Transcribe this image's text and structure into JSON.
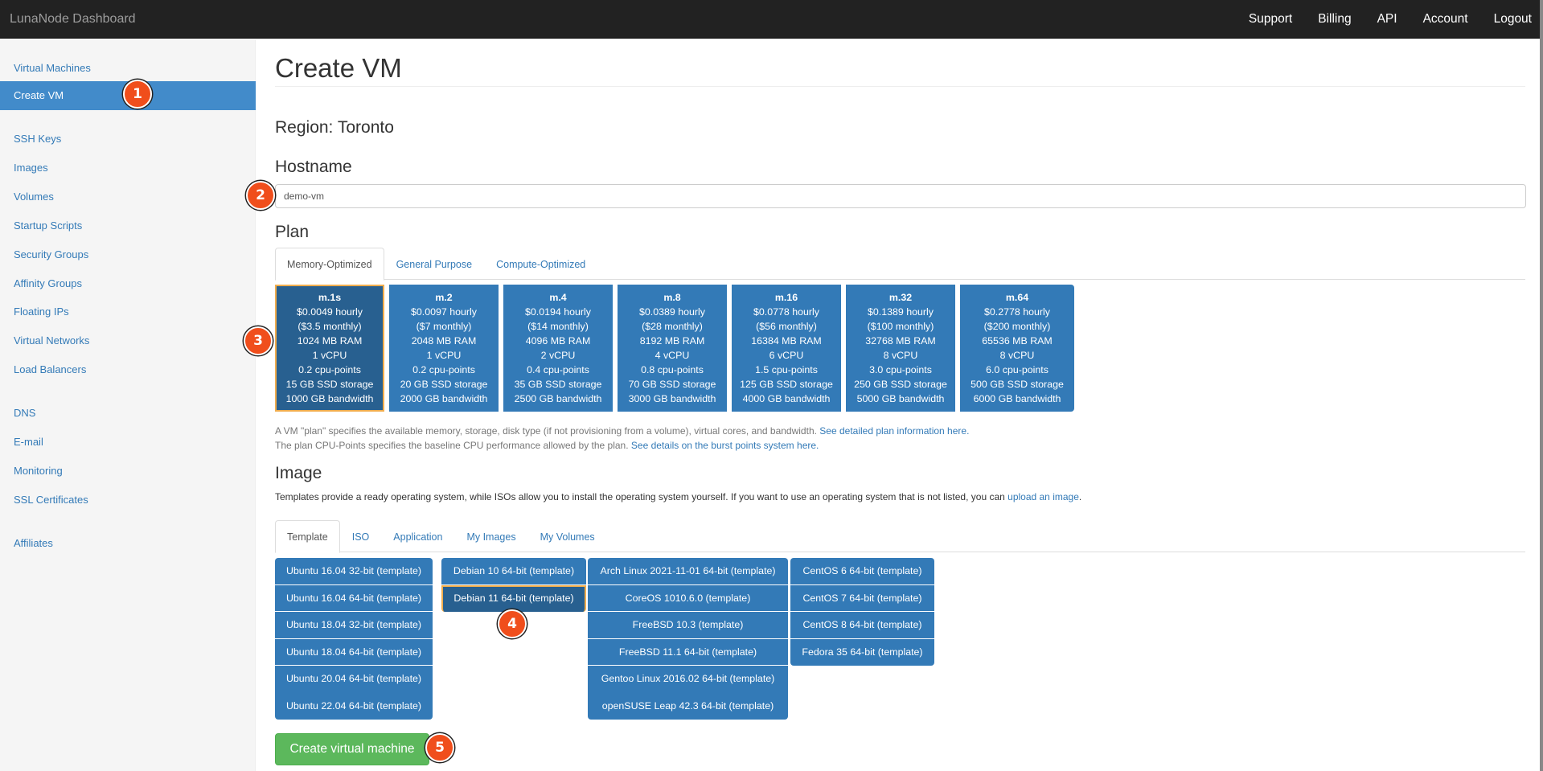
{
  "navbar": {
    "brand": "LunaNode Dashboard",
    "links": [
      "Support",
      "Billing",
      "API",
      "Account",
      "Logout"
    ]
  },
  "sidebar": {
    "items": [
      {
        "label": "Virtual Machines",
        "active": false
      },
      {
        "label": "Create VM",
        "active": true
      },
      {
        "label": "SSH Keys",
        "active": false
      },
      {
        "label": "Images",
        "active": false
      },
      {
        "label": "Volumes",
        "active": false
      },
      {
        "label": "Startup Scripts",
        "active": false
      },
      {
        "label": "Security Groups",
        "active": false
      },
      {
        "label": "Affinity Groups",
        "active": false
      },
      {
        "label": "Floating IPs",
        "active": false
      },
      {
        "label": "Virtual Networks",
        "active": false
      },
      {
        "label": "Load Balancers",
        "active": false
      },
      {
        "label": "DNS",
        "active": false
      },
      {
        "label": "E-mail",
        "active": false
      },
      {
        "label": "Monitoring",
        "active": false
      },
      {
        "label": "SSL Certificates",
        "active": false
      },
      {
        "label": "Affiliates",
        "active": false
      }
    ]
  },
  "main": {
    "title": "Create VM",
    "region": "Region: Toronto",
    "hostname": {
      "heading": "Hostname",
      "value": "demo-vm"
    },
    "plan": {
      "heading": "Plan",
      "tabs": [
        "Memory-Optimized",
        "General Purpose",
        "Compute-Optimized"
      ],
      "active_tab": "Memory-Optimized",
      "selected": "m.1s",
      "plans": [
        {
          "name": "m.1s",
          "hourly": "$0.0049 hourly",
          "monthly": "($3.5 monthly)",
          "ram": "1024 MB RAM",
          "vcpu": "1 vCPU",
          "cpu_points": "0.2 cpu-points",
          "storage": "15 GB SSD storage",
          "bandwidth": "1000 GB bandwidth"
        },
        {
          "name": "m.2",
          "hourly": "$0.0097 hourly",
          "monthly": "($7 monthly)",
          "ram": "2048 MB RAM",
          "vcpu": "1 vCPU",
          "cpu_points": "0.2 cpu-points",
          "storage": "20 GB SSD storage",
          "bandwidth": "2000 GB bandwidth"
        },
        {
          "name": "m.4",
          "hourly": "$0.0194 hourly",
          "monthly": "($14 monthly)",
          "ram": "4096 MB RAM",
          "vcpu": "2 vCPU",
          "cpu_points": "0.4 cpu-points",
          "storage": "35 GB SSD storage",
          "bandwidth": "2500 GB bandwidth"
        },
        {
          "name": "m.8",
          "hourly": "$0.0389 hourly",
          "monthly": "($28 monthly)",
          "ram": "8192 MB RAM",
          "vcpu": "4 vCPU",
          "cpu_points": "0.8 cpu-points",
          "storage": "70 GB SSD storage",
          "bandwidth": "3000 GB bandwidth"
        },
        {
          "name": "m.16",
          "hourly": "$0.0778 hourly",
          "monthly": "($56 monthly)",
          "ram": "16384 MB RAM",
          "vcpu": "6 vCPU",
          "cpu_points": "1.5 cpu-points",
          "storage": "125 GB SSD storage",
          "bandwidth": "4000 GB bandwidth"
        },
        {
          "name": "m.32",
          "hourly": "$0.1389 hourly",
          "monthly": "($100 monthly)",
          "ram": "32768 MB RAM",
          "vcpu": "8 vCPU",
          "cpu_points": "3.0 cpu-points",
          "storage": "250 GB SSD storage",
          "bandwidth": "5000 GB bandwidth"
        },
        {
          "name": "m.64",
          "hourly": "$0.2778 hourly",
          "monthly": "($200 monthly)",
          "ram": "65536 MB RAM",
          "vcpu": "8 vCPU",
          "cpu_points": "6.0 cpu-points",
          "storage": "500 GB SSD storage",
          "bandwidth": "6000 GB bandwidth"
        }
      ],
      "help_line1": "A VM \"plan\" specifies the available memory, storage, disk type (if not provisioning from a volume), virtual cores, and bandwidth. ",
      "help_link1": "See detailed plan information here.",
      "help_line2": "The plan CPU-Points specifies the baseline CPU performance allowed by the plan. ",
      "help_link2": "See details on the burst points system here."
    },
    "image": {
      "heading": "Image",
      "description": "Templates provide a ready operating system, while ISOs allow you to install the operating system yourself. If you want to use an operating system that is not listed, you can ",
      "upload_link": "upload an image",
      "description_end": ".",
      "tabs": [
        "Template",
        "ISO",
        "Application",
        "My Images",
        "My Volumes"
      ],
      "active_tab": "Template",
      "selected": "Debian 11 64-bit (template)",
      "columns": [
        [
          "Ubuntu 16.04 32-bit (template)",
          "Ubuntu 16.04 64-bit (template)",
          "Ubuntu 18.04 32-bit (template)",
          "Ubuntu 18.04 64-bit (template)",
          "Ubuntu 20.04 64-bit (template)",
          "Ubuntu 22.04 64-bit (template)"
        ],
        [
          "Debian 10 64-bit (template)",
          "Debian 11 64-bit (template)"
        ],
        [
          "Arch Linux 2021-11-01 64-bit (template)",
          "CoreOS 1010.6.0 (template)",
          "FreeBSD 10.3 (template)",
          "FreeBSD 11.1 64-bit (template)",
          "Gentoo Linux 2016.02 64-bit (template)",
          "openSUSE Leap 42.3 64-bit (template)"
        ],
        [
          "CentOS 6 64-bit (template)",
          "CentOS 7 64-bit (template)",
          "CentOS 8 64-bit (template)",
          "Fedora 35 64-bit (template)"
        ]
      ]
    },
    "submit_label": "Create virtual machine"
  },
  "annotations": [
    "1",
    "2",
    "3",
    "4",
    "5"
  ],
  "colors": {
    "primary": "#337ab7",
    "selected": "#286090",
    "highlight_border": "#f0ad4e",
    "success": "#5cb85c",
    "marker": "#f04e1c",
    "navbar": "#222222"
  }
}
